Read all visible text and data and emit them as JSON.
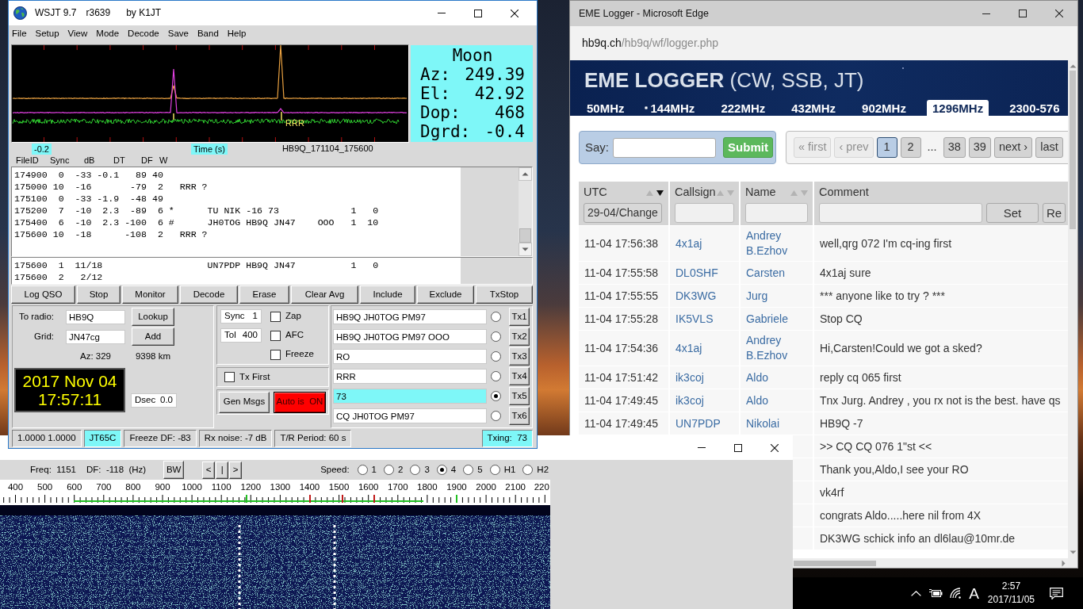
{
  "wsjt": {
    "title": [
      "WSJT 9.7",
      "r3639",
      "by K1JT"
    ],
    "menu": [
      "File",
      "Setup",
      "View",
      "Mode",
      "Decode",
      "Save",
      "Band",
      "Help"
    ],
    "plot": {
      "label": "RRR"
    },
    "moon": {
      "title": "Moon",
      "rows": [
        {
          "label": "Az:",
          "value": "249.39"
        },
        {
          "label": "El:",
          "value": "42.92"
        },
        {
          "label": "Dop:",
          "value": "468"
        },
        {
          "label": "Dgrd:",
          "value": "-0.4"
        }
      ]
    },
    "plot_footer": {
      "dt": "-0.2",
      "axis_label": "Time (s)",
      "file_name": "HB9Q_171104_175600"
    },
    "columns": [
      "FileID",
      "Sync",
      "dB",
      "DT",
      "DF",
      "W"
    ],
    "decodes": [
      "174900  0  -33 -0.1   89 40",
      "175000 10  -16       -79  2   RRR ?",
      "175100  0  -33 -1.9  -48 49",
      "175200  7  -10  2.3  -89  6 *      TU NIK -16 73             1   0",
      "175400  6  -10  2.3 -100  6 #      JH0TOG HB9Q JN47    OOO   1  10",
      "175600 10  -18      -108  2   RRR ?"
    ],
    "averages": [
      "175600  1  11/18                   UN7PDP HB9Q JN47          1   0",
      "175600  2   2/12"
    ],
    "buttons": [
      "Log QSO",
      "Stop",
      "Monitor",
      "Decode",
      "Erase",
      "Clear Avg",
      "Include",
      "Exclude",
      "TxStop"
    ],
    "station": {
      "to_radio_label": "To radio:",
      "to_radio": "HB9Q",
      "lookup": "Lookup",
      "grid_label": "Grid:",
      "grid": "JN47cg",
      "add": "Add",
      "azimuth": "Az: 329",
      "distance": "9398 km",
      "date": "2017 Nov 04",
      "time": "17:57:11",
      "dsec": {
        "label": "Dsec",
        "value": "0.0"
      }
    },
    "decoder": {
      "sync": {
        "label": "Sync",
        "value": "1"
      },
      "tol": {
        "label": "Tol",
        "value": "400"
      },
      "options": [
        {
          "label": "Zap",
          "checked": false
        },
        {
          "label": "AFC",
          "checked": false
        },
        {
          "label": "Freeze",
          "checked": false
        }
      ],
      "tx_first": {
        "label": "Tx First",
        "checked": false
      },
      "gen_msgs": "Gen Msgs",
      "auto": {
        "label": "Auto is  ON",
        "on": true
      }
    },
    "tx_messages": [
      {
        "text": "HB9Q JH0TOG PM97",
        "button": "Tx1",
        "selected": false
      },
      {
        "text": "HB9Q JH0TOG PM97 OOO",
        "button": "Tx2",
        "selected": false
      },
      {
        "text": "RO",
        "button": "Tx3",
        "selected": false
      },
      {
        "text": "RRR",
        "button": "Tx4",
        "selected": false
      },
      {
        "text": "73",
        "button": "Tx5",
        "selected": true
      },
      {
        "text": "CQ JH0TOG PM97",
        "button": "Tx6",
        "selected": false
      }
    ],
    "status": [
      {
        "text": "1.0000 1.0000",
        "highlight": false
      },
      {
        "text": "JT65C",
        "highlight": true
      },
      {
        "text": "Freeze DF: -83",
        "highlight": false
      },
      {
        "text": "Rx noise: -7 dB",
        "highlight": false
      },
      {
        "text": "T/R Period: 60 s",
        "highlight": false
      },
      {
        "text": "Txing:  73",
        "highlight": true
      }
    ]
  },
  "waterfall": {
    "freq": "Freq:  1151",
    "df": "DF:  -118  (Hz)",
    "bw": "BW",
    "nav": [
      "<",
      "|",
      ">"
    ],
    "speed_label": "Speed:",
    "speeds": [
      {
        "label": "1",
        "selected": false
      },
      {
        "label": "2",
        "selected": false
      },
      {
        "label": "3",
        "selected": false
      },
      {
        "label": "4",
        "selected": true
      },
      {
        "label": "5",
        "selected": false
      },
      {
        "label": "H1",
        "selected": false
      },
      {
        "label": "H2",
        "selected": false
      }
    ],
    "scale": [
      "400",
      "500",
      "600",
      "700",
      "800",
      "900",
      "1000",
      "1100",
      "1200",
      "1300",
      "1400",
      "1500",
      "1600",
      "1700",
      "1800",
      "1900",
      "2000",
      "2100",
      "220"
    ]
  },
  "browser": {
    "title": "EME Logger - Microsoft Edge",
    "url": {
      "host": "hb9q.ch",
      "path": "/hb9q/wf/logger.php"
    },
    "heading": "**EME LOGGER** (CW, SSB, JT)",
    "bands": [
      {
        "label": "50MHz",
        "selected": false
      },
      {
        "label": "144MHz",
        "selected": false
      },
      {
        "label": "222MHz",
        "selected": false
      },
      {
        "label": "432MHz",
        "selected": false
      },
      {
        "label": "902MHz",
        "selected": false
      },
      {
        "label": "1296MHz",
        "selected": true
      },
      {
        "label": "2300-576",
        "selected": false
      }
    ],
    "say": {
      "label": "Say:",
      "button": "Submit"
    },
    "pages": [
      {
        "label": "« first",
        "kind": "link",
        "selected": false,
        "disabled": true
      },
      {
        "label": "‹ prev",
        "kind": "link",
        "selected": false,
        "disabled": true
      },
      {
        "label": "1",
        "kind": "link",
        "selected": true,
        "disabled": false
      },
      {
        "label": "2",
        "kind": "link",
        "selected": false,
        "disabled": false
      },
      {
        "label": "...",
        "kind": "gap"
      },
      {
        "label": "38",
        "kind": "link",
        "selected": false,
        "disabled": false
      },
      {
        "label": "39",
        "kind": "link",
        "selected": false,
        "disabled": false
      },
      {
        "label": "next ›",
        "kind": "link",
        "selected": false,
        "disabled": false
      },
      {
        "label": "last",
        "kind": "link",
        "selected": false,
        "disabled": false
      }
    ],
    "columns": [
      {
        "label": "UTC",
        "sort_ascending": false,
        "sort_descending": true
      },
      {
        "label": "Callsign",
        "sort_ascending": false,
        "sort_descending": false
      },
      {
        "label": "Name",
        "sort_ascending": false,
        "sort_descending": false
      },
      {
        "label": "Comment"
      }
    ],
    "filters": {
      "date": "29-04/Change",
      "set": "Set",
      "reset": "Re"
    },
    "rows": [
      {
        "utc": "11-04 17:56:38",
        "callsign": "4x1aj",
        "name": "Andrey B.Ezhov",
        "comment": "well,qrg 072 I'm cq-ing first"
      },
      {
        "utc": "11-04 17:55:58",
        "callsign": "DL0SHF",
        "name": "Carsten",
        "comment": "4x1aj sure"
      },
      {
        "utc": "11-04 17:55:55",
        "callsign": "DK3WG",
        "name": "Jurg",
        "comment": "*** anyone like to try ? ***"
      },
      {
        "utc": "11-04 17:55:28",
        "callsign": "IK5VLS",
        "name": "Gabriele",
        "comment": "Stop CQ"
      },
      {
        "utc": "11-04 17:54:36",
        "callsign": "4x1aj",
        "name": "Andrey B.Ezhov",
        "comment": "Hi,Carsten!Could we got a sked?"
      },
      {
        "utc": "11-04 17:51:42",
        "callsign": "ik3coj",
        "name": "Aldo",
        "comment": "reply cq 065 first"
      },
      {
        "utc": "11-04 17:49:45",
        "callsign": "ik3coj",
        "name": "Aldo",
        "comment": "Tnx Jurg. Andrey , you rx not is the best. have qs"
      },
      {
        "utc": "11-04 17:49:45",
        "callsign": "UN7PDP",
        "name": "Nikolai",
        "comment": "HB9Q -7"
      },
      {
        "comment": ">> CQ CQ 076 1\"st <<"
      },
      {
        "comment": "Thank you,Aldo,I see your RO"
      },
      {
        "comment": "vk4rf"
      },
      {
        "comment": "congrats Aldo.....here nil from 4X"
      },
      {
        "comment": "DK3WG schick info an dl6lau@10mr.de"
      }
    ]
  },
  "taskbar": {
    "ime": "A",
    "time": "2:57",
    "date": "2017/11/05"
  }
}
